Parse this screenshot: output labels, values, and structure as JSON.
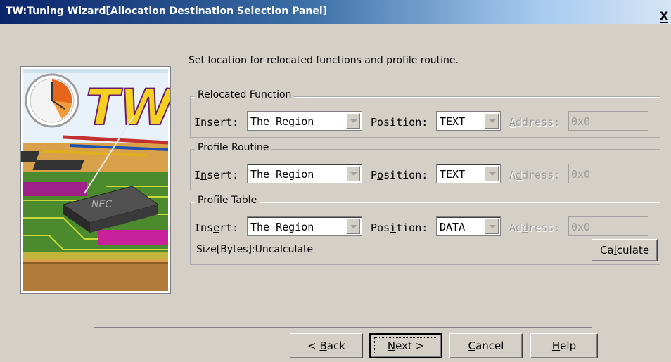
{
  "window": {
    "title": "TW:Tuning Wizard[Allocation Destination Selection Panel]",
    "close_glyph": "X"
  },
  "instruction": "Set location for relocated functions and profile routine.",
  "image": {
    "logo_text": "TW",
    "chip_text": "NEC"
  },
  "groups": [
    {
      "legend": "Relocated Function",
      "insert": {
        "label_pre": "",
        "label_mnemonic": "I",
        "label_post": "nsert:",
        "value": "The Region"
      },
      "position": {
        "label_pre": "",
        "label_mnemonic": "P",
        "label_post": "osition:",
        "value": "TEXT"
      },
      "address": {
        "label_pre": "",
        "label_mnemonic": "A",
        "label_post": "ddress:",
        "value": "0x0"
      }
    },
    {
      "legend": "Profile Routine",
      "insert": {
        "label_pre": "I",
        "label_mnemonic": "n",
        "label_post": "sert:",
        "value": "The Region"
      },
      "position": {
        "label_pre": "P",
        "label_mnemonic": "o",
        "label_post": "sition:",
        "value": "TEXT"
      },
      "address": {
        "label_pre": "A",
        "label_mnemonic": "d",
        "label_post": "dress:",
        "value": "0x0"
      }
    },
    {
      "legend": "Profile Table",
      "insert": {
        "label_pre": "Ins",
        "label_mnemonic": "e",
        "label_post": "rt:",
        "value": "The Region"
      },
      "position": {
        "label_pre": "Pos",
        "label_mnemonic": "i",
        "label_post": "tion:",
        "value": "DATA"
      },
      "address": {
        "label_pre": "Ad",
        "label_mnemonic": "d",
        "label_post": "ress:",
        "value": "0x0"
      },
      "size_text": "Size[Bytes]:Uncalculate",
      "calculate": {
        "pre": "Ca",
        "mnemonic": "l",
        "post": "culate"
      }
    }
  ],
  "buttons": {
    "back": {
      "pre": "< ",
      "mnemonic": "B",
      "post": "ack"
    },
    "next": {
      "pre": "",
      "mnemonic": "N",
      "post": "ext >"
    },
    "cancel": {
      "pre": "",
      "mnemonic": "C",
      "post": "ancel"
    },
    "help": {
      "pre": "",
      "mnemonic": "H",
      "post": "elp"
    }
  }
}
